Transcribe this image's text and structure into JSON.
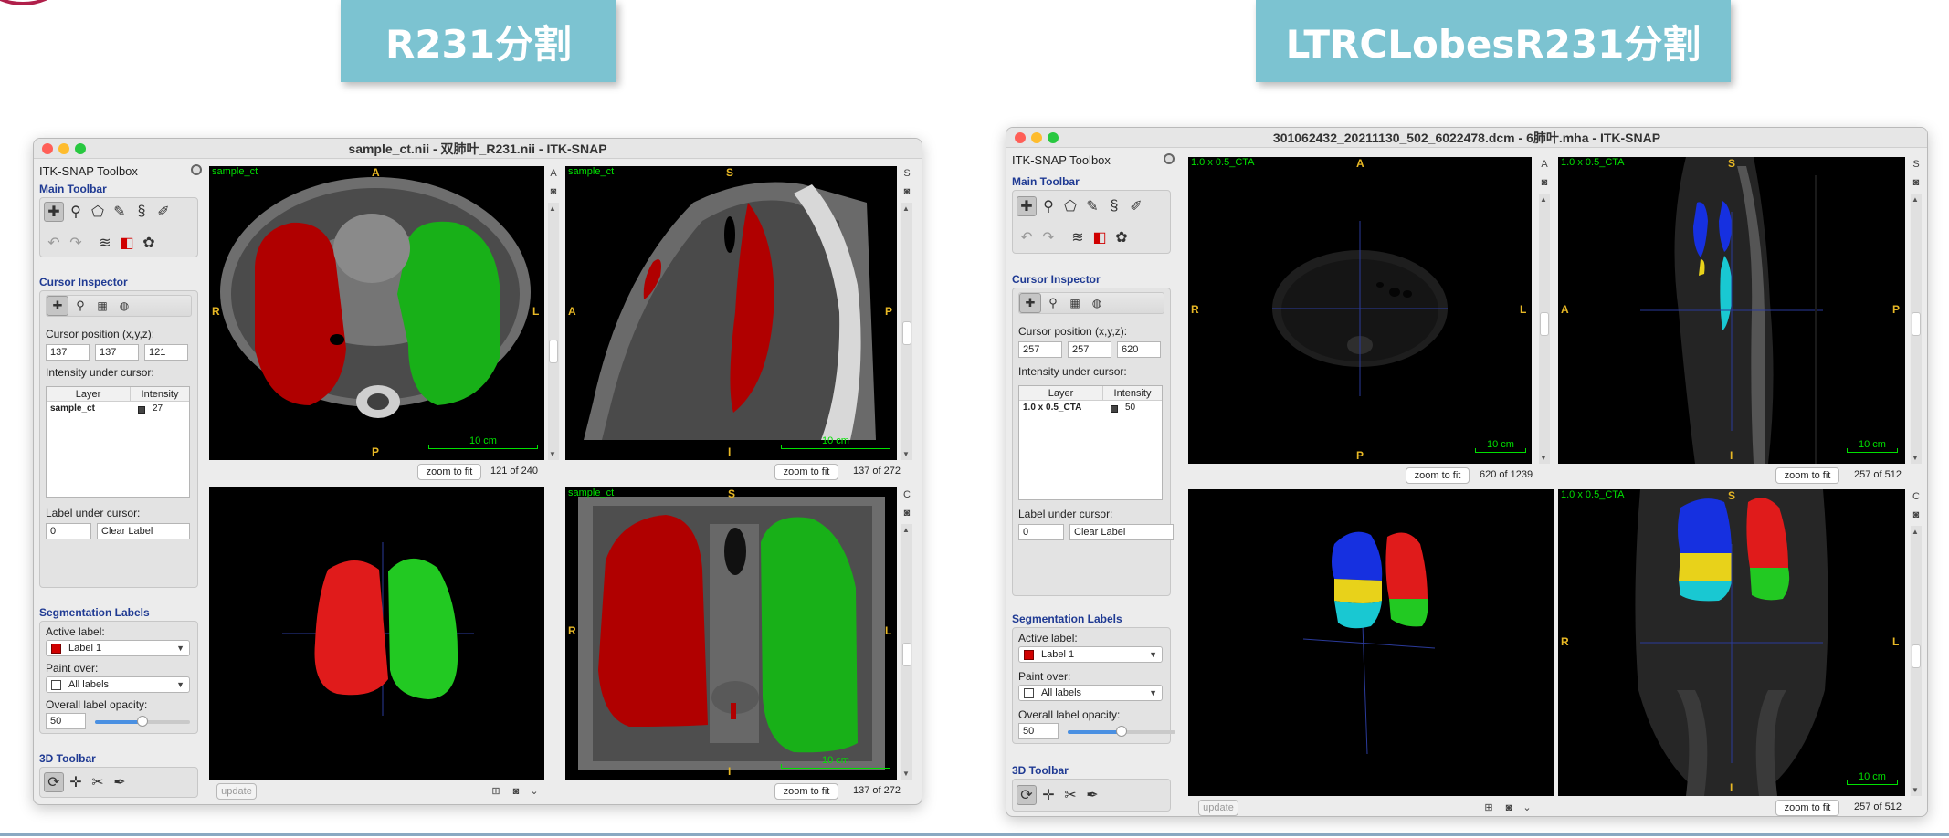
{
  "slide": {
    "left_title": "R231分割",
    "right_title": "LTRCLobesR231分割"
  },
  "left_window": {
    "title": "sample_ct.nii - 双肺叶_R231.nii - ITK-SNAP",
    "toolbox_title": "ITK-SNAP Toolbox",
    "main_toolbar_label": "Main Toolbar",
    "cursor_inspector_label": "Cursor Inspector",
    "cursor_position_label": "Cursor position (x,y,z):",
    "cursor_x": "137",
    "cursor_y": "137",
    "cursor_z": "121",
    "intensity_label": "Intensity under cursor:",
    "table_headers": [
      "Layer",
      "Intensity"
    ],
    "table_layer": "sample_ct",
    "table_intensity": "27",
    "label_under_cursor_label": "Label under cursor:",
    "label_under_cursor_value": "0",
    "label_under_cursor_name": "Clear Label",
    "seg_labels_label": "Segmentation Labels",
    "active_label_label": "Active label:",
    "active_label_value": "Label 1",
    "paint_over_label": "Paint over:",
    "paint_over_value": "All labels",
    "opacity_label": "Overall label opacity:",
    "opacity_value": "50",
    "opacity_fraction": 0.5,
    "toolbar3d_label": "3D Toolbar",
    "update_button": "update",
    "zoom_to_fit": "zoom to fit",
    "axial_name": "sample_ct",
    "axial_slice": "121 of 240",
    "sagittal_name": "sample_ct",
    "sagittal_slice": "137 of 272",
    "coronal_name": "sample_ct",
    "coronal_slice": "137 of 272",
    "scale_label": "10 cm"
  },
  "right_window": {
    "title": "301062432_20211130_502_6022478.dcm - 6肺叶.mha - ITK-SNAP",
    "toolbox_title": "ITK-SNAP Toolbox",
    "main_toolbar_label": "Main Toolbar",
    "cursor_inspector_label": "Cursor Inspector",
    "cursor_position_label": "Cursor position (x,y,z):",
    "cursor_x": "257",
    "cursor_y": "257",
    "cursor_z": "620",
    "intensity_label": "Intensity under cursor:",
    "table_headers": [
      "Layer",
      "Intensity"
    ],
    "table_layer": "1.0 x 0.5_CTA",
    "table_intensity": "50",
    "label_under_cursor_label": "Label under cursor:",
    "label_under_cursor_value": "0",
    "label_under_cursor_name": "Clear Label",
    "seg_labels_label": "Segmentation Labels",
    "active_label_label": "Active label:",
    "active_label_value": "Label 1",
    "paint_over_label": "Paint over:",
    "paint_over_value": "All labels",
    "opacity_label": "Overall label opacity:",
    "opacity_value": "50",
    "opacity_fraction": 0.5,
    "toolbar3d_label": "3D Toolbar",
    "update_button": "update",
    "zoom_to_fit": "zoom to fit",
    "axial_name": "1.0 x 0.5_CTA",
    "axial_slice": "620 of 1239",
    "sagittal_name": "1.0 x 0.5_CTA",
    "sagittal_slice": "257 of 512",
    "coronal_name": "1.0 x 0.5_CTA",
    "coronal_slice": "257 of 512",
    "scale_label": "10 cm"
  },
  "orientation": {
    "A": "A",
    "P": "P",
    "R": "R",
    "L": "L",
    "S": "S",
    "I": "I"
  },
  "colors": {
    "title_bg": "#7cc3d1",
    "label_red": "#d00000",
    "label_green": "#1fb51f",
    "lobe_blue": "#1630e0",
    "lobe_yellow": "#e8d21a",
    "lobe_cyan": "#19c8d2",
    "overlay_text": "#00e000",
    "orientation_text": "#e8b825",
    "section_title": "#1f3a93"
  },
  "icons": {
    "main_toolbar": [
      "crosshair-icon",
      "zoom-icon",
      "polygon-icon",
      "paintbrush-icon",
      "snake-icon",
      "annotation-icon",
      "undo-icon",
      "redo-icon",
      "layers-icon",
      "label-color-icon",
      "palette-icon"
    ],
    "cursor_inspector": [
      "crosshair-icon",
      "zoom-icon",
      "grid-icon",
      "window-icon"
    ],
    "toolbar3d": [
      "rotate-icon",
      "crosshair3d-icon",
      "scalpel-icon",
      "spray-icon"
    ]
  }
}
